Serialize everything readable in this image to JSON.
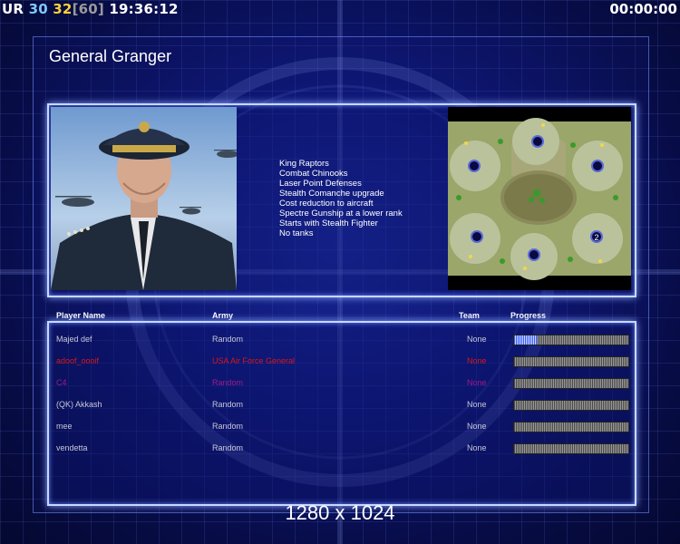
{
  "hud": {
    "label": "UR",
    "count_a": "30",
    "count_b": "32",
    "count_max": "[60]",
    "clock": "19:36:12",
    "timer": "00:00:00"
  },
  "general": {
    "name": "General Granger",
    "traits": [
      "King Raptors",
      "Combat Chinooks",
      "Laser Point Defenses",
      "Stealth Comanche upgrade",
      "Cost reduction to aircraft",
      "Spectre Gunship at a lower rank",
      "Starts with Stealth Fighter",
      "No tanks"
    ]
  },
  "minimap": {
    "marker_label": "2"
  },
  "players": {
    "headers": {
      "name": "Player Name",
      "army": "Army",
      "team": "Team",
      "progress": "Progress"
    },
    "rows": [
      {
        "name": "Majed def",
        "army": "Random",
        "team": "None",
        "progress": 0.2,
        "color": "#c8c8d8"
      },
      {
        "name": "adoof_oooif",
        "army": "USA Air Force General",
        "team": "None",
        "progress": 0.0,
        "color": "#d81818"
      },
      {
        "name": "C4",
        "army": "Random",
        "team": "None",
        "progress": 0.0,
        "color": "#a01a8a"
      },
      {
        "name": "(QK) Akkash",
        "army": "Random",
        "team": "None",
        "progress": 0.0,
        "color": "#c8c8d8"
      },
      {
        "name": "mee",
        "army": "Random",
        "team": "None",
        "progress": 0.0,
        "color": "#c8c8d8"
      },
      {
        "name": "vendetta",
        "army": "Random",
        "team": "None",
        "progress": 0.0,
        "color": "#c8c8d8"
      }
    ]
  },
  "resolution": "1280 x 1024"
}
